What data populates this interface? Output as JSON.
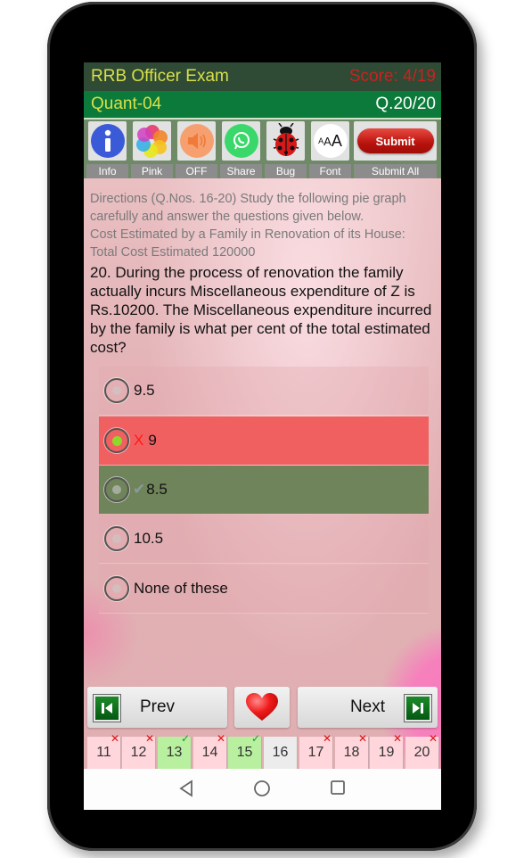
{
  "header": {
    "app_title": "RRB Officer Exam",
    "score": "Score: 4/19",
    "section": "Quant-04",
    "question_counter": "Q.20/20"
  },
  "toolbar": {
    "items": [
      {
        "icon": "info-icon",
        "label": "Info"
      },
      {
        "icon": "color-palette-icon",
        "label": "Pink"
      },
      {
        "icon": "speaker-icon",
        "label": "OFF"
      },
      {
        "icon": "whatsapp-icon",
        "label": "Share"
      },
      {
        "icon": "ladybug-icon",
        "label": "Bug"
      },
      {
        "icon": "font-size-icon",
        "label": "Font",
        "glyph": "AAA"
      }
    ],
    "submit_button": "Submit",
    "submit_label": "Submit All"
  },
  "directions": {
    "line1": "Directions (Q.Nos. 16-20) Study the following pie graph carefully and answer the questions given below.",
    "line2": "Cost Estimated by a Family in Renovation of its House:",
    "line3": "Total Cost Estimated 120000"
  },
  "question": {
    "text": "20. During the process of renovation the family actually incurs Miscellaneous expenditure of Z is Rs.10200. The Miscellaneous expenditure incurred by the family is what per cent of the total estimated cost?"
  },
  "options": [
    {
      "text": "9.5",
      "state": "plain"
    },
    {
      "text": "9",
      "state": "wrong",
      "selected": true,
      "mark": "X"
    },
    {
      "text": "8.5",
      "state": "correct",
      "mark": "✔"
    },
    {
      "text": "10.5",
      "state": "plain"
    },
    {
      "text": "None of these",
      "state": "plain"
    }
  ],
  "navigation": {
    "prev_label": "Prev",
    "next_label": "Next",
    "favorite_icon": "heart-icon"
  },
  "question_strip": [
    {
      "num": "11",
      "status": "wrong",
      "mark": "✕"
    },
    {
      "num": "12",
      "status": "wrong",
      "mark": "✕"
    },
    {
      "num": "13",
      "status": "right",
      "mark": "✓"
    },
    {
      "num": "14",
      "status": "wrong",
      "mark": "✕"
    },
    {
      "num": "15",
      "status": "right",
      "mark": "✓"
    },
    {
      "num": "16",
      "status": "none",
      "mark": ""
    },
    {
      "num": "17",
      "status": "wrong",
      "mark": "✕"
    },
    {
      "num": "18",
      "status": "wrong",
      "mark": "✕"
    },
    {
      "num": "19",
      "status": "wrong",
      "mark": "✕"
    },
    {
      "num": "20",
      "status": "wrong",
      "mark": "✕"
    }
  ],
  "colors": {
    "title_bar": "#2f4a35",
    "section_bar": "#0c7a3a",
    "title_text": "#d8e04a",
    "score_text": "#c8231e",
    "wrong_option": "#f06060",
    "correct_option": "#6f845a"
  }
}
